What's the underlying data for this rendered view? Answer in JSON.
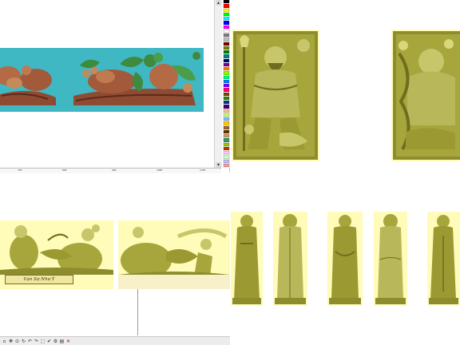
{
  "cad_window": {
    "ruler_ticks": [
      "700",
      "800",
      "900",
      "1000",
      "1100"
    ],
    "palette_colors": [
      "#000000",
      "#ff0000",
      "#ffff00",
      "#00ff00",
      "#00ffff",
      "#0000ff",
      "#ff00ff",
      "#ffffff",
      "#808080",
      "#c0c0c0",
      "#800000",
      "#808000",
      "#008000",
      "#008080",
      "#000080",
      "#800080",
      "#ff8000",
      "#80ff00",
      "#00ff80",
      "#0080ff",
      "#8000ff",
      "#ff0080",
      "#804000",
      "#408000",
      "#004080",
      "#400080",
      "#ffc080",
      "#c0ff80",
      "#80c0ff",
      "#ffcc00",
      "#996633",
      "#663300",
      "#cc9966",
      "#339966",
      "#99cc00",
      "#cc3300",
      "#ffccff",
      "#ccffcc",
      "#c0c0ff",
      "#ff9999"
    ],
    "relief_bg": "#3fb8c4"
  },
  "nameplate": {
    "text": "Vạn Sự Như Ý"
  },
  "colors": {
    "sheet": "#fefcb8",
    "model": "#a7a63c",
    "model_dark": "#6f6e1e",
    "model_light": "#d8d77c",
    "wood": "#a35a3a",
    "wood_dark": "#6b3422",
    "leaf": "#3e8a3e"
  }
}
